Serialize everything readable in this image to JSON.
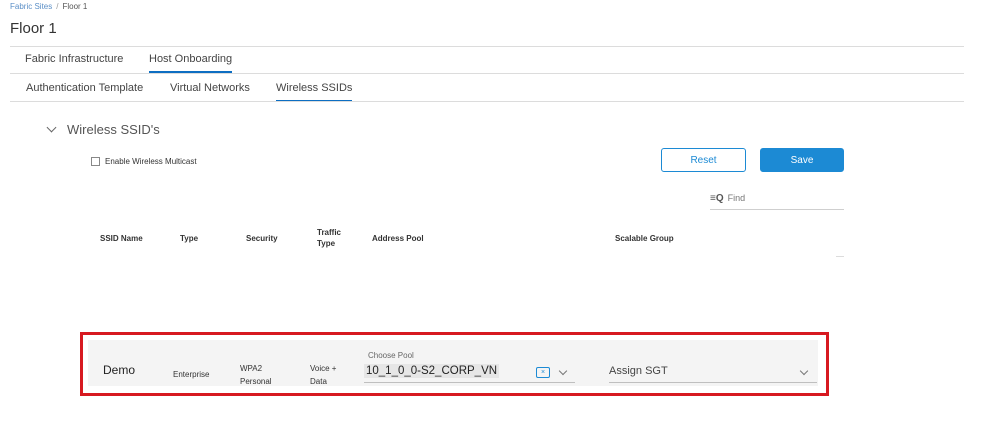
{
  "breadcrumb": {
    "items": [
      "Fabric Sites",
      "Floor 1"
    ],
    "separator": "/"
  },
  "page": {
    "title": "Floor 1"
  },
  "main_tabs": [
    {
      "label": "Fabric Infrastructure",
      "active": false
    },
    {
      "label": "Host Onboarding",
      "active": true
    }
  ],
  "sub_tabs": [
    {
      "label": "Authentication Template",
      "active": false
    },
    {
      "label": "Virtual Networks",
      "active": false
    },
    {
      "label": "Wireless SSIDs",
      "active": true
    }
  ],
  "section": {
    "title": "Wireless SSID's",
    "multicast_label": "Enable Wireless Multicast",
    "multicast_checked": false
  },
  "toolbar": {
    "reset_label": "Reset",
    "save_label": "Save",
    "find_placeholder": "Find",
    "find_icon": "list-search-icon"
  },
  "table": {
    "headers": {
      "ssid": "SSID Name",
      "type": "Type",
      "security": "Security",
      "traffic_1": "Traffic",
      "traffic_2": "Type",
      "pool": "Address Pool",
      "sgt": "Scalable Group"
    },
    "row": {
      "ssid": "Demo",
      "type": "Enterprise",
      "security_1": "WPA2",
      "security_2": "Personal",
      "traffic_1": "Voice +",
      "traffic_2": "Data",
      "pool_label": "Choose Pool",
      "pool_value": "10_1_0_0-S2_CORP_VN",
      "sgt_placeholder": "Assign SGT"
    }
  },
  "colors": {
    "accent": "#1c8ad4",
    "highlight_border": "#d71920"
  }
}
